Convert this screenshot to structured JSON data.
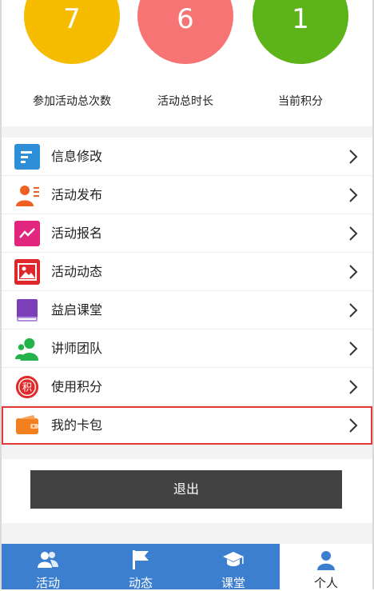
{
  "stats": [
    {
      "value": "7",
      "label": "参加活动总次数",
      "color": "#F5BC00"
    },
    {
      "value": "6",
      "label": "活动总时长",
      "color": "#F67474"
    },
    {
      "value": "1",
      "label": "当前积分",
      "color": "#5DB419"
    }
  ],
  "menu": {
    "items": [
      {
        "label": "信息修改",
        "icon": "info-edit-icon",
        "color": "#2e8fd8"
      },
      {
        "label": "活动发布",
        "icon": "publish-icon",
        "color": "#f06023"
      },
      {
        "label": "活动报名",
        "icon": "signup-chart-icon",
        "color": "#e0267e"
      },
      {
        "label": "活动动态",
        "icon": "photo-icon",
        "color": "#e0262d"
      },
      {
        "label": "益启课堂",
        "icon": "book-icon",
        "color": "#7b3fb8"
      },
      {
        "label": "讲师团队",
        "icon": "team-icon",
        "color": "#23b34a"
      },
      {
        "label": "使用积分",
        "icon": "points-icon",
        "color": "#e12b2b"
      },
      {
        "label": "我的卡包",
        "icon": "wallet-icon",
        "color": "#f2801f"
      }
    ]
  },
  "logout": {
    "label": "退出"
  },
  "tabbar": {
    "tabs": [
      {
        "label": "活动",
        "icon": "people-icon"
      },
      {
        "label": "动态",
        "icon": "flag-icon"
      },
      {
        "label": "课堂",
        "icon": "graduation-cap-icon"
      },
      {
        "label": "个人",
        "icon": "person-icon"
      }
    ],
    "active": "个人",
    "color": "#3d7fcf"
  }
}
